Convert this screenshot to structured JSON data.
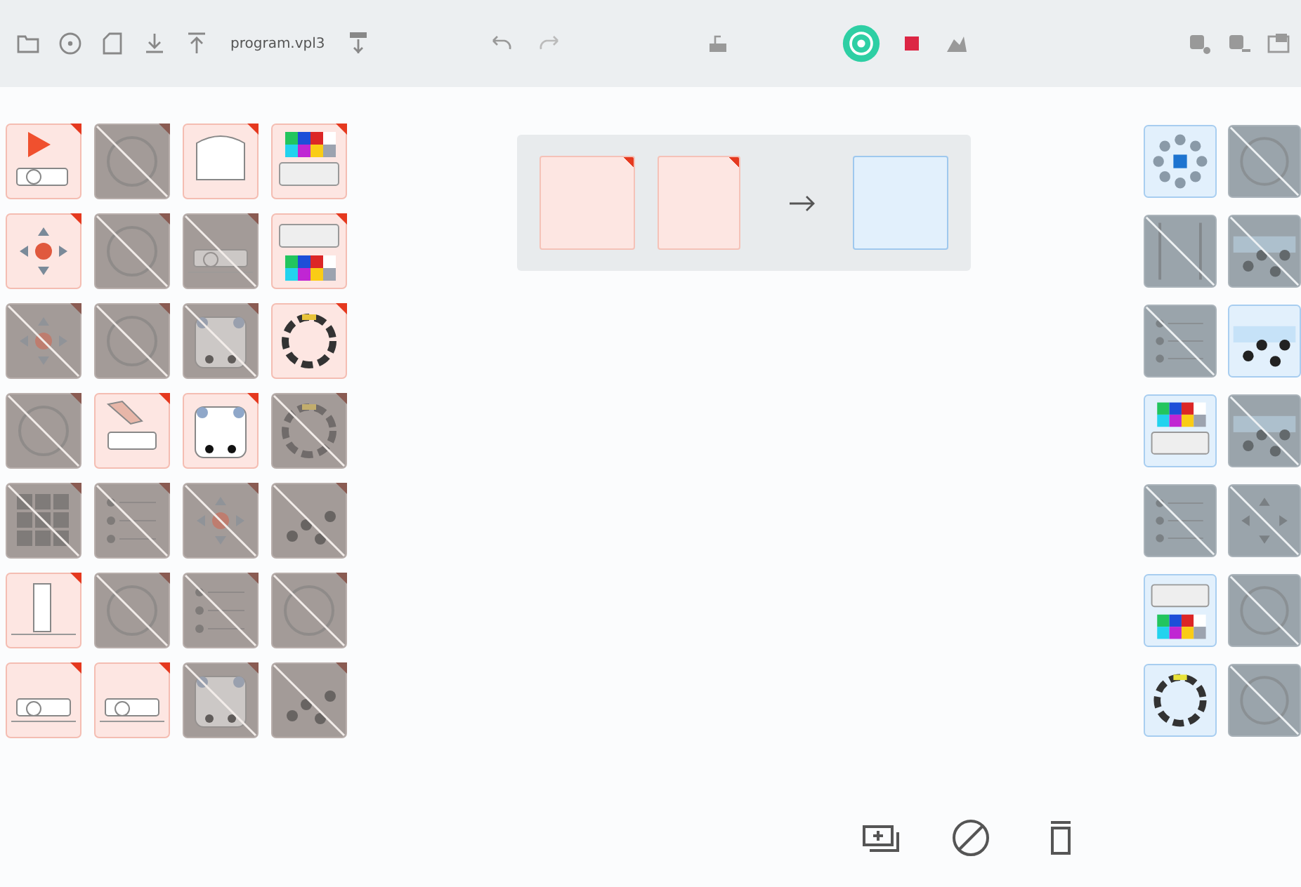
{
  "toolbar": {
    "filename": "program.vpl3"
  },
  "event_palette": [
    {
      "kind": "play",
      "disabled": false
    },
    {
      "kind": "circle",
      "disabled": true
    },
    {
      "kind": "robot-top",
      "disabled": false
    },
    {
      "kind": "color-top",
      "disabled": false
    },
    {
      "kind": "arrows",
      "disabled": false
    },
    {
      "kind": "circle",
      "disabled": true
    },
    {
      "kind": "side",
      "disabled": true
    },
    {
      "kind": "color-bottom",
      "disabled": false
    },
    {
      "kind": "arrows",
      "disabled": true
    },
    {
      "kind": "circle",
      "disabled": true
    },
    {
      "kind": "sensors",
      "disabled": true
    },
    {
      "kind": "ring",
      "disabled": false
    },
    {
      "kind": "circle",
      "disabled": true
    },
    {
      "kind": "hand",
      "disabled": false
    },
    {
      "kind": "sensors",
      "disabled": false
    },
    {
      "kind": "ring",
      "disabled": true
    },
    {
      "kind": "grid",
      "disabled": true
    },
    {
      "kind": "list",
      "disabled": true
    },
    {
      "kind": "arrows",
      "disabled": true
    },
    {
      "kind": "notes",
      "disabled": true
    },
    {
      "kind": "vertical",
      "disabled": false
    },
    {
      "kind": "circle",
      "disabled": true
    },
    {
      "kind": "list",
      "disabled": true
    },
    {
      "kind": "circle",
      "disabled": true
    },
    {
      "kind": "side",
      "disabled": false
    },
    {
      "kind": "side",
      "disabled": false
    },
    {
      "kind": "sensors",
      "disabled": true
    },
    {
      "kind": "notes",
      "disabled": true
    }
  ],
  "action_palette": [
    {
      "kind": "motor",
      "disabled": false
    },
    {
      "kind": "circle",
      "disabled": true
    },
    {
      "kind": "vertical",
      "disabled": true
    },
    {
      "kind": "notes",
      "disabled": true
    },
    {
      "kind": "list",
      "disabled": true
    },
    {
      "kind": "notes",
      "disabled": false
    },
    {
      "kind": "color-top",
      "disabled": false
    },
    {
      "kind": "notes",
      "disabled": true
    },
    {
      "kind": "list",
      "disabled": true
    },
    {
      "kind": "arrows",
      "disabled": true
    },
    {
      "kind": "color-bottom",
      "disabled": false
    },
    {
      "kind": "circle",
      "disabled": true
    },
    {
      "kind": "ring",
      "disabled": false
    },
    {
      "kind": "circle",
      "disabled": true
    }
  ],
  "program": {
    "rules": [
      {
        "events": [
          {
            "kind": "empty"
          },
          {
            "kind": "empty"
          }
        ],
        "actions": [
          {
            "kind": "empty"
          }
        ]
      }
    ]
  }
}
